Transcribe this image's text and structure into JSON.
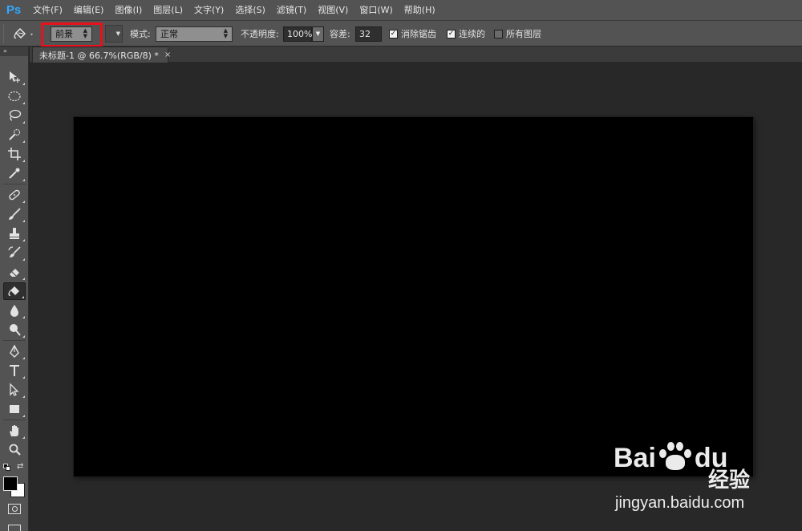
{
  "app": {
    "logo": "Ps"
  },
  "menu": [
    "文件(F)",
    "编辑(E)",
    "图像(I)",
    "图层(L)",
    "文字(Y)",
    "选择(S)",
    "滤镜(T)",
    "视图(V)",
    "窗口(W)",
    "帮助(H)"
  ],
  "options": {
    "tool_icon": "paint-bucket-icon",
    "fill_source": "前景",
    "mode_label": "模式:",
    "mode_value": "正常",
    "opacity_label": "不透明度:",
    "opacity_value": "100%",
    "tolerance_label": "容差:",
    "tolerance_value": "32",
    "antialias_label": "消除锯齿",
    "antialias_checked": true,
    "contiguous_label": "连续的",
    "contiguous_checked": true,
    "all_layers_label": "所有图层",
    "all_layers_checked": false
  },
  "document_tab": {
    "title": "未标题-1 @ 66.7%(RGB/8) *",
    "close": "×"
  },
  "tools": [
    "move-icon",
    "marquee-icon",
    "lasso-icon",
    "quick-select-icon",
    "crop-icon",
    "eyedropper-icon",
    "healing-brush-icon",
    "brush-icon",
    "clone-stamp-icon",
    "history-brush-icon",
    "eraser-icon",
    "paint-bucket-icon",
    "blur-icon",
    "dodge-icon",
    "pen-icon",
    "type-icon",
    "path-select-icon",
    "rectangle-icon",
    "hand-icon",
    "zoom-icon"
  ],
  "colors": {
    "foreground": "#000000",
    "background": "#ffffff",
    "canvas": "#000000",
    "highlight": "#e8101a"
  },
  "watermark": {
    "logo_left": "Bai",
    "logo_right": "du",
    "cn_text": "经验",
    "url": "jingyan.baidu.com"
  }
}
